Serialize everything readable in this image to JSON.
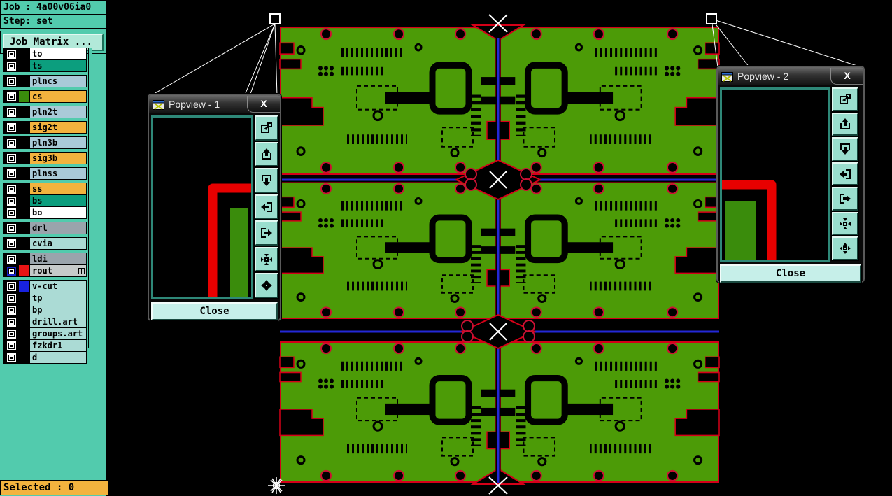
{
  "header": {
    "job_line": "Job : 4a00v06ia0",
    "step_line": "Step: set",
    "job_matrix_button": "Job Matrix ..."
  },
  "status_bar": {
    "selected_label": "Selected : 0"
  },
  "layer_panel": {
    "groups": [
      {
        "items": [
          {
            "label": "to",
            "bg": "#ffffff"
          },
          {
            "label": "ts",
            "bg": "#0c9e7e"
          }
        ]
      },
      {
        "items": [
          {
            "label": "plncs",
            "bg": "#a9cad8"
          }
        ]
      },
      {
        "items": [
          {
            "label": "cs",
            "bg": "#f2b33e",
            "swatch": "#3a8c0c"
          }
        ]
      },
      {
        "items": [
          {
            "label": "pln2t",
            "bg": "#a9cad8"
          }
        ]
      },
      {
        "items": [
          {
            "label": "sig2t",
            "bg": "#f2b33e"
          }
        ]
      },
      {
        "items": [
          {
            "label": "pln3b",
            "bg": "#a9cad8"
          }
        ]
      },
      {
        "items": [
          {
            "label": "sig3b",
            "bg": "#f2b33e"
          }
        ]
      },
      {
        "items": [
          {
            "label": "plnss",
            "bg": "#a9cad8"
          }
        ]
      },
      {
        "items": [
          {
            "label": "ss",
            "bg": "#f2b33e"
          },
          {
            "label": "bs",
            "bg": "#0c9e7e"
          },
          {
            "label": "bo",
            "bg": "#ffffff"
          }
        ]
      },
      {
        "items": [
          {
            "label": "drl",
            "bg": "#9aa4ac"
          }
        ]
      },
      {
        "items": [
          {
            "label": "cvia",
            "bg": "#abdbd5"
          }
        ]
      },
      {
        "items": [
          {
            "label": "ldi",
            "bg": "#9aa4ac"
          },
          {
            "label": "rout",
            "bg": "#c6caca",
            "swatch": "#e81414",
            "checkbox_accent": "#1822cc",
            "grid_icon": true
          }
        ]
      },
      {
        "items": [
          {
            "label": "v-cut",
            "bg": "#abdbd5",
            "swatch": "#1822e0"
          },
          {
            "label": "tp",
            "bg": "#abdbd5"
          },
          {
            "label": "bp",
            "bg": "#abdbd5"
          },
          {
            "label": "drill.art",
            "bg": "#abdbd5"
          },
          {
            "label": "groups.art",
            "bg": "#abdbd5"
          },
          {
            "label": "fzkdr1",
            "bg": "#abdbd5"
          },
          {
            "label": "d",
            "bg": "#abdbd5"
          }
        ]
      }
    ]
  },
  "popviews": [
    {
      "title": "Popview - 1",
      "close_label": "Close",
      "close_icon": "X",
      "buttons": [
        "popview-copy",
        "pan-up",
        "pan-down",
        "pan-left",
        "pan-right",
        "zoom-contract",
        "zoom-expand"
      ]
    },
    {
      "title": "Popview - 2",
      "close_label": "Close",
      "close_icon": "X",
      "buttons": [
        "popview-copy",
        "pan-up",
        "pan-down",
        "pan-left",
        "pan-right",
        "zoom-contract",
        "zoom-expand"
      ]
    }
  ],
  "colors": {
    "sidebar_teal": "#52cbad",
    "pcb_green": "#4c9b07",
    "board_outline_red": "#d40018",
    "drill_ring_red": "#cc1133",
    "vcut_blue": "#2328d8",
    "selected_bar_orange": "#f2b33e",
    "trace_red": "#e80000"
  }
}
